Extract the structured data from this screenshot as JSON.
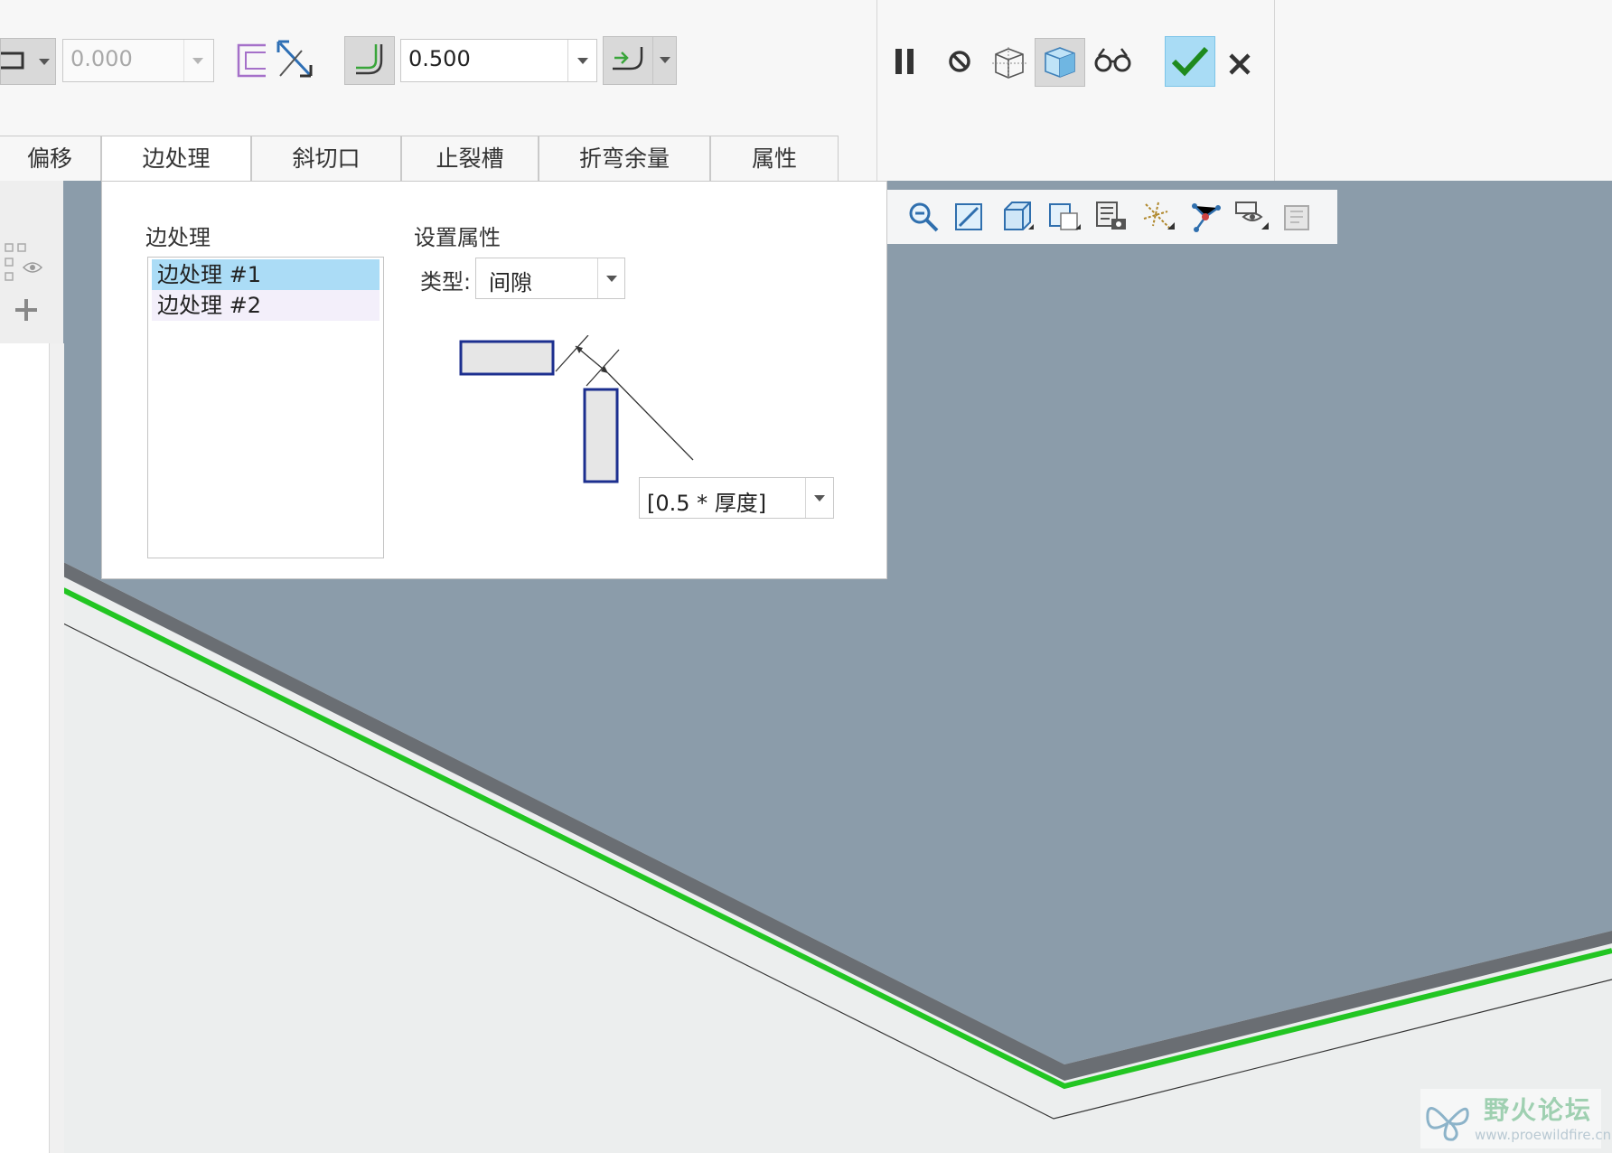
{
  "ribbon": {
    "offset_value": "0.000",
    "gap_value": "0.500",
    "icons": [
      "flip-edge-icon",
      "offset-edge-icon",
      "swap-direction-icon",
      "bend-radius-icon",
      "bend-side-icon"
    ],
    "controls": [
      "pause-icon",
      "no-preview-icon",
      "wireframe-preview-icon",
      "shaded-preview-icon",
      "verify-icon",
      "confirm-check-icon",
      "cancel-x-icon"
    ],
    "colors": {
      "confirm_bg": "#a9dcf5",
      "check_green": "#1e8a1e",
      "pressed_bg": "#d9d9d9"
    }
  },
  "tabs": [
    {
      "label": "偏移",
      "active": false
    },
    {
      "label": "边处理",
      "active": true
    },
    {
      "label": "斜切口",
      "active": false
    },
    {
      "label": "止裂槽",
      "active": false
    },
    {
      "label": "折弯余量",
      "active": false
    },
    {
      "label": "属性",
      "active": false
    }
  ],
  "panel": {
    "list_title": "边处理",
    "items": [
      "边处理 #1",
      "边处理 #2"
    ],
    "selected_index": 0,
    "props_title": "设置属性",
    "type_label": "类型:",
    "type_value": "间隙",
    "gap_formula": "[0.5 * 厚度]"
  },
  "view_toolbar": {
    "icons": [
      "zoom-out-icon",
      "refit-icon",
      "saved-orientations-icon",
      "view-manager-icon",
      "display-style-icon",
      "datum-display-icon",
      "spin-center-icon",
      "annotation-display-icon",
      "appearance-icon"
    ]
  },
  "viewport": {
    "colors": {
      "background": "#eceeee",
      "sheet_top": "#8b9caa",
      "sheet_edge": "#6a6e73",
      "highlight_edge": "#22c522"
    }
  },
  "watermark": {
    "title": "野火论坛",
    "url": "www.proewildfire.cn"
  }
}
